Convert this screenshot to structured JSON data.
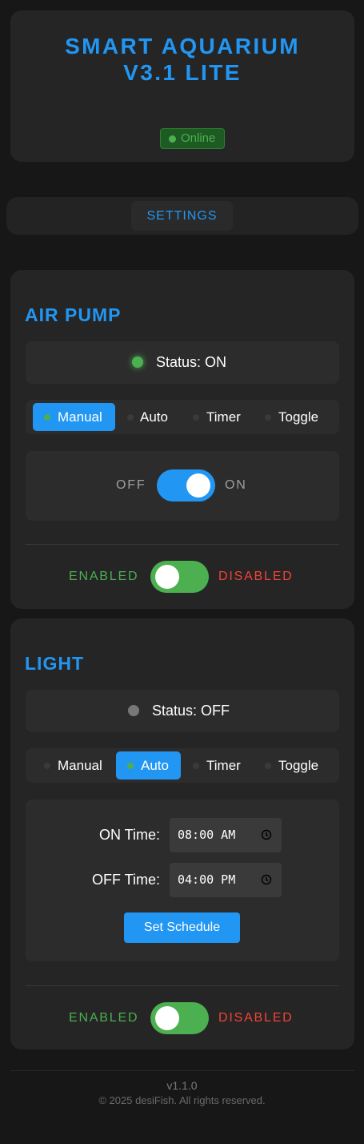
{
  "header": {
    "title_line1": "SMART AQUARIUM",
    "title_line2": "V3.1 LITE",
    "status": "Online"
  },
  "settings": {
    "label": "SETTINGS"
  },
  "air_pump": {
    "title": "AIR PUMP",
    "status": "Status: ON",
    "modes": [
      "Manual",
      "Auto",
      "Timer",
      "Toggle"
    ],
    "active_mode": "Manual",
    "manual": {
      "off_label": "OFF",
      "on_label": "ON",
      "state": "on"
    },
    "enable": {
      "enabled_label": "ENABLED",
      "disabled_label": "DISABLED"
    }
  },
  "light": {
    "title": "LIGHT",
    "status": "Status: OFF",
    "modes": [
      "Manual",
      "Auto",
      "Timer",
      "Toggle"
    ],
    "active_mode": "Auto",
    "schedule": {
      "on_label": "ON Time:",
      "on_value": "08:00 AM",
      "off_label": "OFF Time:",
      "off_value": "04:00 PM",
      "button": "Set Schedule"
    },
    "enable": {
      "enabled_label": "ENABLED",
      "disabled_label": "DISABLED"
    }
  },
  "footer": {
    "version": "v1.1.0",
    "copyright": "© 2025 desiFish. All rights reserved."
  },
  "colors": {
    "accent": "#2196f3",
    "on": "#4caf50",
    "enabled_text": "#4caf50",
    "disabled_text": "#f44336",
    "off_dot": "#777777"
  }
}
